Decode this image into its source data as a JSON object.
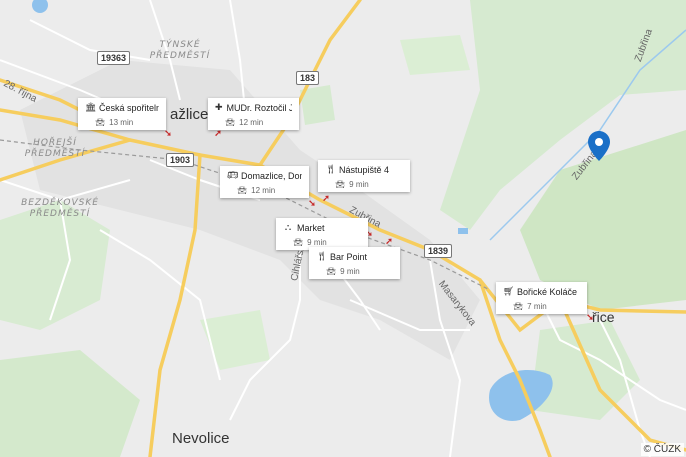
{
  "map": {
    "places": [
      {
        "name": "Česká spořitelna",
        "icon": "bank-icon",
        "time": "13 min"
      },
      {
        "name": "MUDr. Roztočil Ja...",
        "icon": "medical-icon",
        "time": "12 min"
      },
      {
        "name": "Domazlice, Doma...",
        "icon": "bus-icon",
        "time": "12 min"
      },
      {
        "name": "Nástupiště 4",
        "icon": "restaurant-icon",
        "time": "9 min"
      },
      {
        "name": "Market",
        "icon": "market-icon",
        "time": "9 min"
      },
      {
        "name": "Bar Point",
        "icon": "restaurant-icon",
        "time": "9 min"
      },
      {
        "name": "Bořické Koláče",
        "icon": "shop-icon",
        "time": "7 min"
      }
    ],
    "district_labels": {
      "tynske": "TÝNSKÉ\nPŘEDMĚSTÍ",
      "horejsi": "HOŘEJŠÍ\nPŘEDMĚSTÍ",
      "bezdekovske": "BEZDĚKOVSKÉ\nPŘEDMĚSTÍ"
    },
    "towns": {
      "domazlice_partial": "ažlice",
      "nevolice": "Nevolice",
      "borice_partial": "řice"
    },
    "road_shields": {
      "r19363": "19363",
      "r183": "183",
      "r1903": "1903",
      "r1839": "1839"
    },
    "streets": {
      "zubrina_1": "Zubřina",
      "zubrina_2": "Zubřina",
      "zubrina_3": "Zubřina",
      "masarykova": "Masarykova",
      "ciklarska": "Cihlářská",
      "rijna": "28. října"
    },
    "copyright": "© ČÚZK",
    "colors": {
      "background": "#ececec",
      "forest": "#cfe6c4",
      "water": "#8ec1ec",
      "road_main": "#f6cd5e",
      "pin": "#1a6fc7",
      "arrow": "#c62828"
    }
  }
}
